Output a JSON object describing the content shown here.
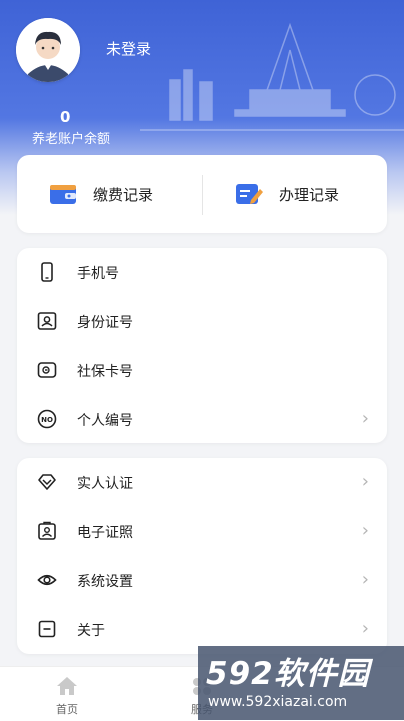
{
  "header": {
    "login_status": "未登录",
    "balance_value": "0",
    "balance_label": "养老账户余额"
  },
  "records": {
    "payment_label": "缴费记录",
    "handling_label": "办理记录"
  },
  "info_list": [
    {
      "label": "手机号",
      "icon": "phone-icon"
    },
    {
      "label": "身份证号",
      "icon": "id-card-icon"
    },
    {
      "label": "社保卡号",
      "icon": "social-card-icon"
    },
    {
      "label": "个人编号",
      "icon": "number-icon"
    }
  ],
  "settings_list": [
    {
      "label": "实人认证",
      "icon": "verify-icon"
    },
    {
      "label": "电子证照",
      "icon": "e-license-icon"
    },
    {
      "label": "系统设置",
      "icon": "eye-settings-icon"
    },
    {
      "label": "关于",
      "icon": "about-icon"
    }
  ],
  "tabbar": {
    "home_label": "首页",
    "service_label": "服务"
  },
  "watermark": {
    "brand": "592软件园",
    "url": "www.592xiazai.com"
  },
  "colors": {
    "header_blue": "#3f63d6",
    "accent": "#3a6ee8",
    "orange": "#f0a040"
  }
}
